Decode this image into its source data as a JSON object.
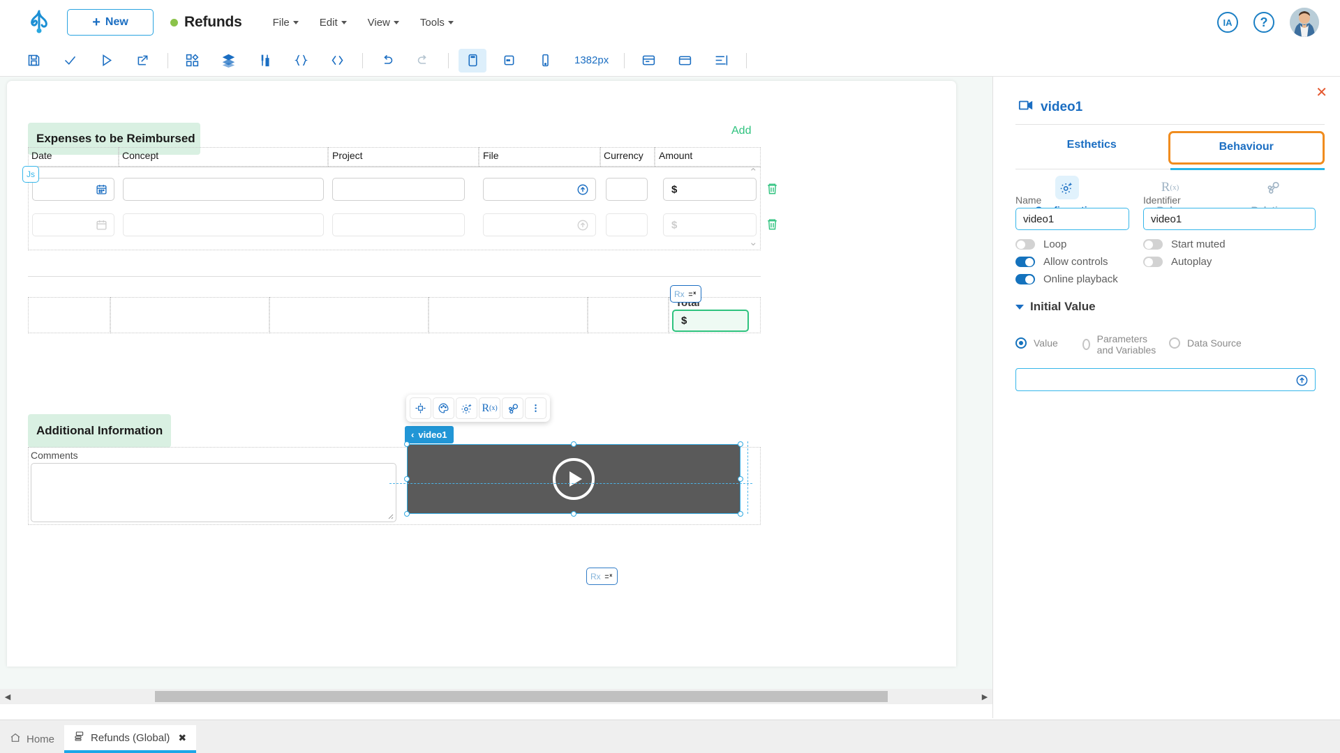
{
  "topbar": {
    "logo_icon": "bonita-logo-icon",
    "new_button": {
      "label": "New",
      "icon": "plus-icon"
    },
    "app_title": "Refunds",
    "status_dot_color": "#8bc34a",
    "menus": [
      {
        "label": "File"
      },
      {
        "label": "Edit"
      },
      {
        "label": "View"
      },
      {
        "label": "Tools"
      }
    ],
    "right": {
      "ia_label": "IA",
      "help_label": "?",
      "avatar_name": "user-avatar"
    }
  },
  "toolbar": {
    "items": [
      {
        "name": "save-icon",
        "title": "Save"
      },
      {
        "name": "check-icon",
        "title": "Validate"
      },
      {
        "name": "play-icon",
        "title": "Run"
      },
      {
        "name": "export-icon",
        "title": "Export"
      },
      {
        "name": "widgets-icon",
        "title": "Widgets"
      },
      {
        "name": "layers-icon",
        "title": "Layers"
      },
      {
        "name": "variables-icon",
        "title": "Variables"
      },
      {
        "name": "braces-icon",
        "title": "Expressions"
      },
      {
        "name": "code-icon",
        "title": "Code"
      },
      {
        "name": "undo-icon",
        "title": "Undo"
      },
      {
        "name": "redo-icon",
        "title": "Redo"
      },
      {
        "name": "desktop-icon",
        "title": "Desktop"
      },
      {
        "name": "tablet-icon",
        "title": "Tablet"
      },
      {
        "name": "mobile-icon",
        "title": "Mobile"
      },
      {
        "name": "form-icon",
        "title": "Form"
      },
      {
        "name": "container-icon",
        "title": "Container"
      },
      {
        "name": "align-icon",
        "title": "Align"
      }
    ],
    "width_label": "1382px"
  },
  "canvas": {
    "expenses": {
      "section_title": "Expenses to be Reimbursed",
      "add_link": "Add",
      "columns": [
        "Date",
        "Concept",
        "Project",
        "File",
        "Currency",
        "Amount"
      ],
      "rows": [
        {
          "amount_prefix": "$",
          "active": true
        },
        {
          "amount_prefix": "$",
          "active": false
        }
      ],
      "js_badge": "Js",
      "date_icon": "calendar-icon",
      "upload_icon": "upload-icon",
      "delete_icon": "trash-icon"
    },
    "totals": {
      "label": "Total",
      "amount_prefix": "$",
      "rx_badge": "Rx"
    },
    "additional": {
      "section_title": "Additional Information",
      "comments_label": "Comments"
    },
    "video": {
      "element_tag": "video1",
      "play_icon": "play-icon"
    },
    "float_toolbar": [
      {
        "name": "move-icon"
      },
      {
        "name": "palette-icon"
      },
      {
        "name": "gear-sparkle-icon"
      },
      {
        "name": "rx-icon",
        "label": "R(x)"
      },
      {
        "name": "relations-icon"
      },
      {
        "name": "more-vertical-icon"
      }
    ]
  },
  "right_panel": {
    "close_icon": "close-icon",
    "title": "video1",
    "title_icon": "video-icon",
    "tabs": [
      {
        "label": "Esthetics",
        "active": false
      },
      {
        "label": "Behaviour",
        "active": true
      }
    ],
    "subtabs": [
      {
        "label": "Configuration",
        "icon": "gear-sparkle-icon",
        "active": true
      },
      {
        "label": "Rules",
        "icon": "rx-icon",
        "active": false
      },
      {
        "label": "Relations",
        "icon": "relations-icon",
        "active": false
      }
    ],
    "fields": {
      "name_label": "Name",
      "name_value": "video1",
      "identifier_label": "Identifier",
      "identifier_value": "video1"
    },
    "toggles": [
      {
        "label": "Loop",
        "on": false
      },
      {
        "label": "Start muted",
        "on": false
      },
      {
        "label": "Allow controls",
        "on": true
      },
      {
        "label": "Autoplay",
        "on": false
      },
      {
        "label": "Online playback",
        "on": true
      }
    ],
    "initial_value": {
      "title": "Initial Value",
      "options": [
        {
          "label": "Value",
          "selected": true
        },
        {
          "label": "Parameters and Variables",
          "selected": false
        },
        {
          "label": "Data Source",
          "selected": false
        }
      ],
      "input_value": "",
      "input_icon": "upload-icon"
    }
  },
  "footer": {
    "tabs": [
      {
        "label": "Home",
        "icon": "home-icon",
        "active": false,
        "closable": false
      },
      {
        "label": "Refunds (Global)",
        "icon": "page-icon",
        "active": true,
        "closable": true,
        "close_icon": "close-icon"
      }
    ]
  },
  "colors": {
    "accent_blue": "#1b6ec2",
    "cyan": "#29b6e8",
    "orange": "#f08c1e",
    "green": "#2ec27e",
    "section_green_bg": "#d9f0e2"
  }
}
